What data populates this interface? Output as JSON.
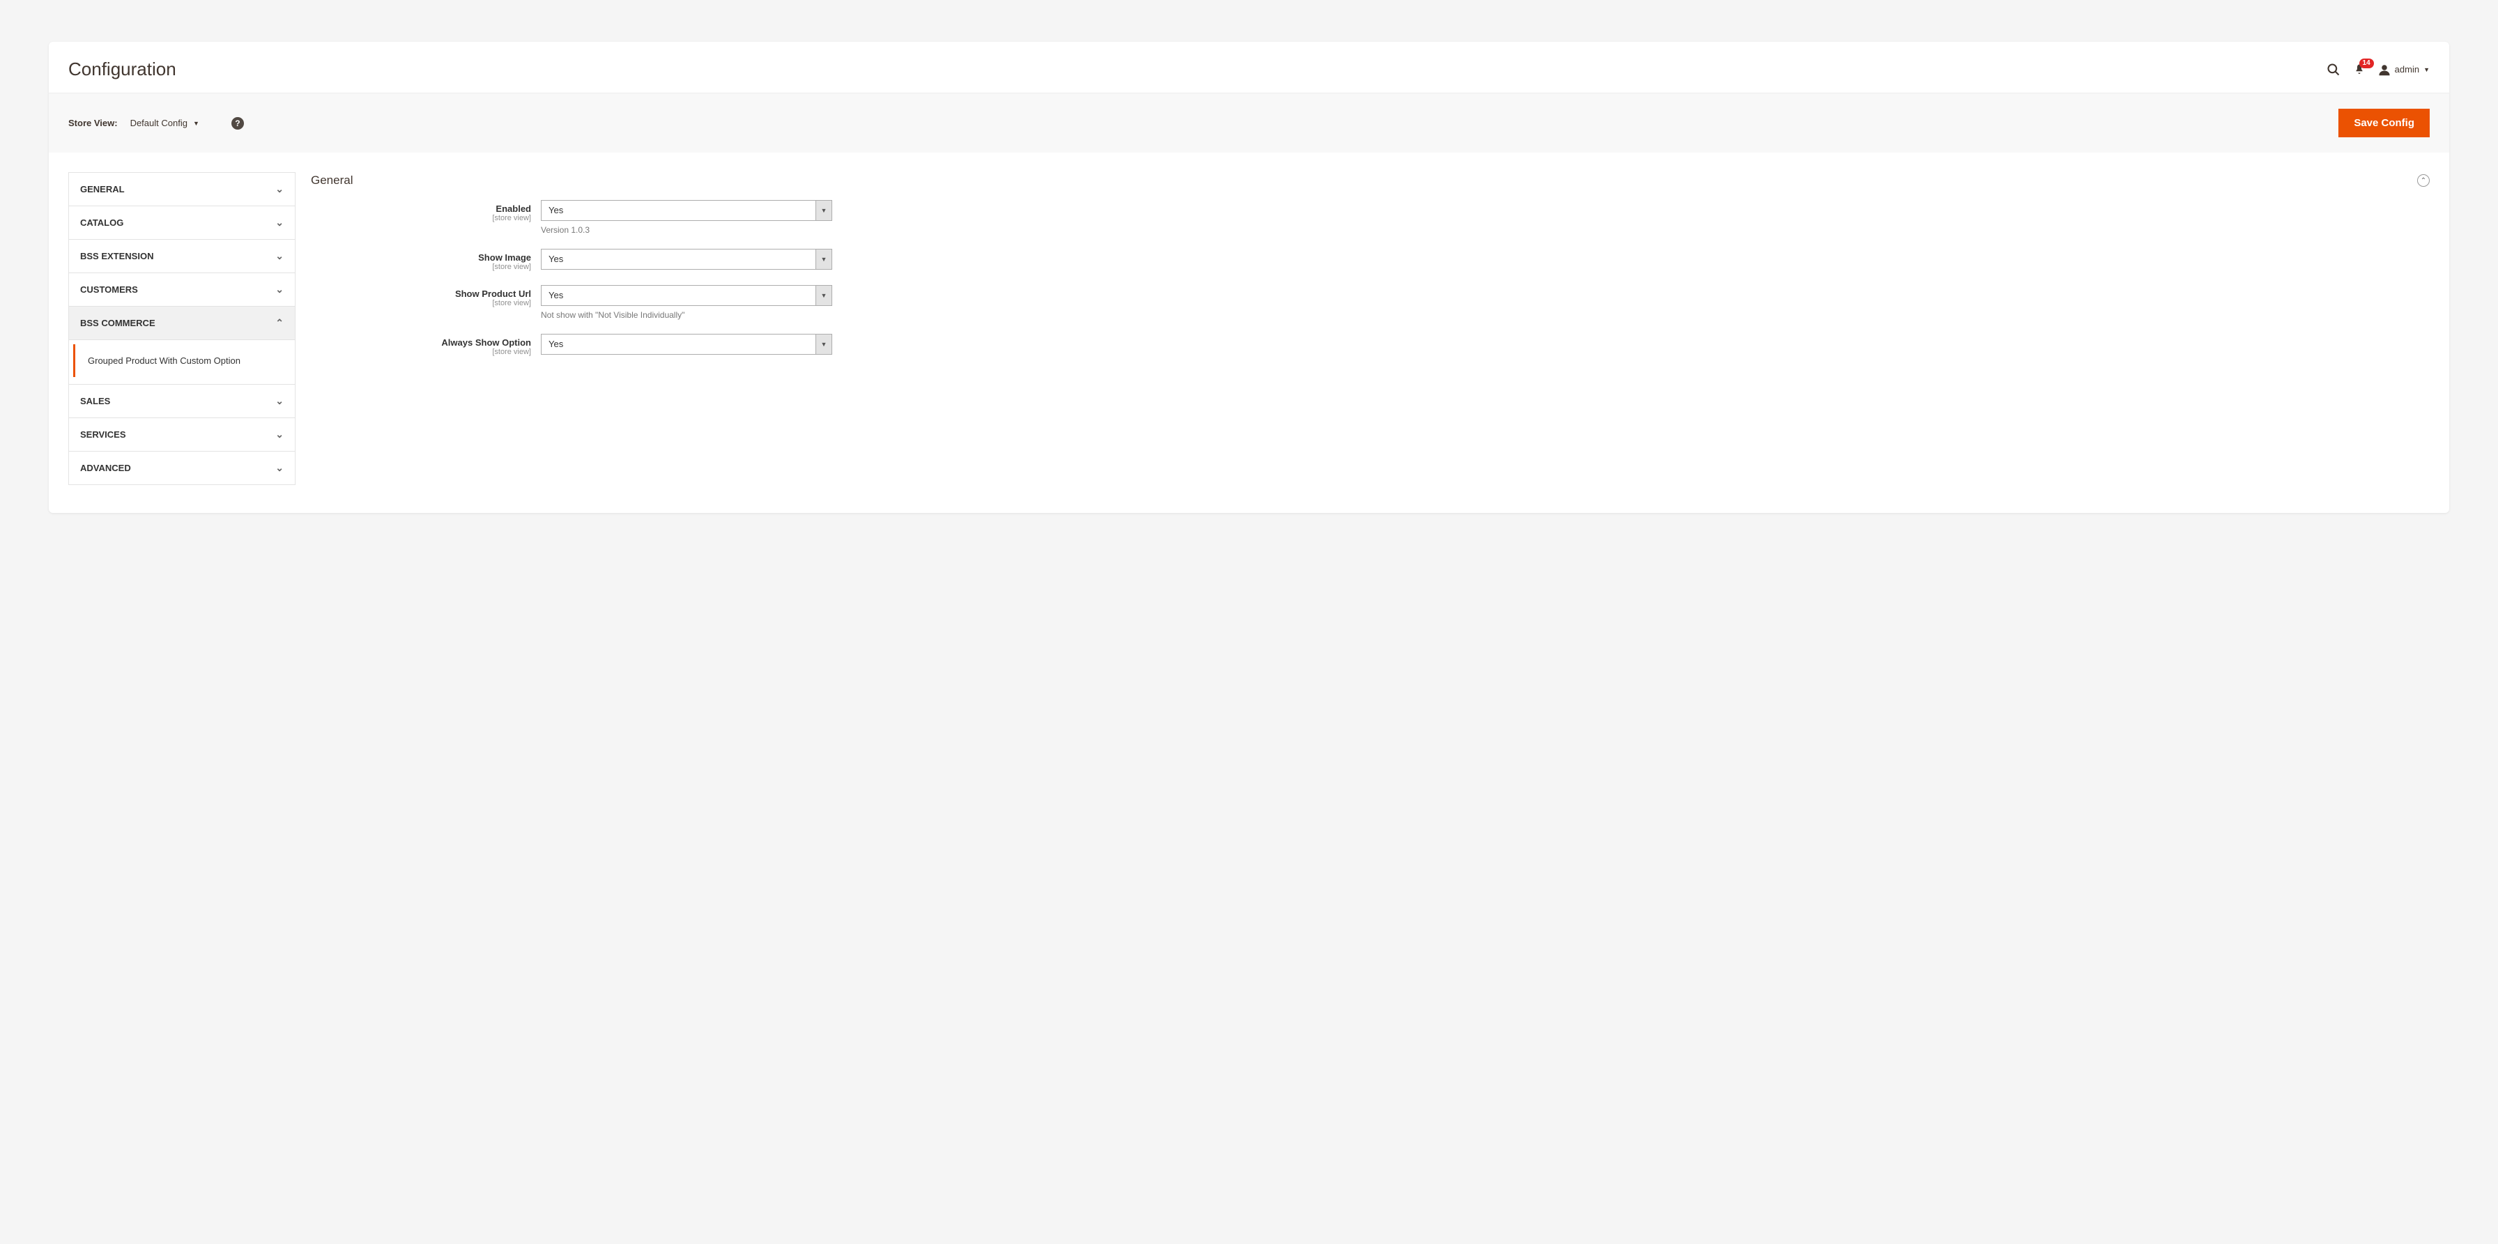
{
  "header": {
    "title": "Configuration",
    "notification_count": "14",
    "username": "admin"
  },
  "toolbar": {
    "store_view_label": "Store View:",
    "store_view_value": "Default Config",
    "save_label": "Save Config"
  },
  "sidebar": {
    "sections": [
      {
        "label": "GENERAL",
        "expanded": false
      },
      {
        "label": "CATALOG",
        "expanded": false
      },
      {
        "label": "BSS EXTENSION",
        "expanded": false
      },
      {
        "label": "CUSTOMERS",
        "expanded": false
      },
      {
        "label": "BSS COMMERCE",
        "expanded": true,
        "sub": "Grouped Product With Custom Option"
      },
      {
        "label": "SALES",
        "expanded": false
      },
      {
        "label": "SERVICES",
        "expanded": false
      },
      {
        "label": "ADVANCED",
        "expanded": false
      }
    ]
  },
  "main": {
    "section_title": "General",
    "fields": {
      "enabled": {
        "label": "Enabled",
        "scope": "[store view]",
        "value": "Yes",
        "note": "Version 1.0.3"
      },
      "show_image": {
        "label": "Show Image",
        "scope": "[store view]",
        "value": "Yes"
      },
      "show_product_url": {
        "label": "Show Product Url",
        "scope": "[store view]",
        "value": "Yes",
        "note": "Not show with \"Not Visible Individually\""
      },
      "always_show_option": {
        "label": "Always Show Option",
        "scope": "[store view]",
        "value": "Yes"
      }
    }
  }
}
